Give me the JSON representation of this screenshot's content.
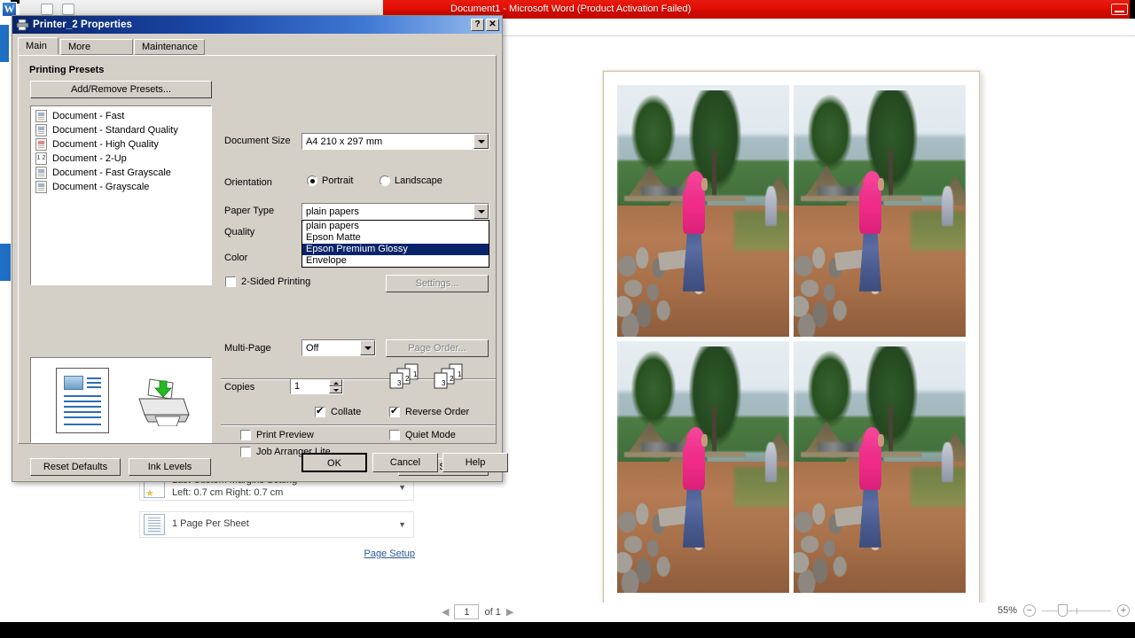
{
  "word": {
    "title": "Document1 - Microsoft Word (Product Activation Failed)",
    "app_icon": "word-w-icon",
    "minimize_label": "—",
    "settings": {
      "margins_label": "Last Custom Margins Setting",
      "margins_values": "Left: 0.7 cm   Right: 0.7 cm",
      "pages_per_sheet": "1 Page Per Sheet",
      "page_setup_link": "Page Setup"
    },
    "status": {
      "page_current": "1",
      "page_of": "of 1",
      "prev_arrow": "◀",
      "next_arrow": "▶",
      "zoom_level": "55%",
      "zoom_out": "−",
      "zoom_in": "+"
    },
    "preview": {
      "photo_count": 4,
      "photo_alt": "Woman in pink hijab and blue skirt standing on rocks along a dirt path, thatched huts, trees and river in background"
    }
  },
  "dialog": {
    "title": "Printer_2 Properties",
    "title_icon": "printer-icon",
    "help_btn": "?",
    "close_btn": "✕",
    "tabs": [
      {
        "label": "Main",
        "active": true
      },
      {
        "label": "More Options",
        "active": false
      },
      {
        "label": "Maintenance",
        "active": false
      }
    ],
    "presets": {
      "section_title": "Printing Presets",
      "add_remove_label": "Add/Remove Presets...",
      "items": [
        {
          "label": "Document - Fast",
          "icon": "doc-fast-icon"
        },
        {
          "label": "Document - Standard Quality",
          "icon": "doc-standard-icon"
        },
        {
          "label": "Document - High Quality",
          "icon": "doc-high-icon"
        },
        {
          "label": "Document - 2-Up",
          "icon": "doc-2up-icon"
        },
        {
          "label": "Document - Fast Grayscale",
          "icon": "doc-fast-gray-icon"
        },
        {
          "label": "Document - Grayscale",
          "icon": "doc-gray-icon"
        }
      ]
    },
    "fields": {
      "document_size_label": "Document Size",
      "document_size_value": "A4 210 x 297 mm",
      "orientation_label": "Orientation",
      "orientation_portrait": "Portrait",
      "orientation_landscape": "Landscape",
      "orientation_selected": "Portrait",
      "paper_type_label": "Paper Type",
      "paper_type_value": "plain papers",
      "paper_type_options": [
        {
          "label": "plain papers",
          "selected": false
        },
        {
          "label": "Epson Matte",
          "selected": false
        },
        {
          "label": "Epson Premium Glossy",
          "selected": true
        },
        {
          "label": "Envelope",
          "selected": false
        }
      ],
      "quality_label": "Quality",
      "color_label": "Color",
      "two_sided_label": "2-Sided Printing",
      "two_sided_checked": false,
      "settings_btn": "Settings...",
      "multipage_label": "Multi-Page",
      "multipage_value": "Off",
      "page_order_btn": "Page Order...",
      "copies_label": "Copies",
      "copies_value": "1",
      "collate_label": "Collate",
      "collate_checked": true,
      "reverse_order_label": "Reverse Order",
      "reverse_order_checked": true,
      "print_preview_label": "Print Preview",
      "print_preview_checked": false,
      "quiet_mode_label": "Quiet Mode",
      "quiet_mode_checked": false,
      "job_arranger_label": "Job Arranger Lite",
      "job_arranger_checked": false,
      "show_settings_btn": "Show Settings"
    },
    "buttons": {
      "reset_defaults": "Reset Defaults",
      "ink_levels": "Ink Levels",
      "ok": "OK",
      "cancel": "Cancel",
      "help": "Help"
    }
  },
  "colors": {
    "dialog_face": "#d4d0c8",
    "title_blue": "#0a246a",
    "word_red": "#d40a01",
    "selection_blue": "#0a246a",
    "accent_pink": "#ef2a86"
  }
}
